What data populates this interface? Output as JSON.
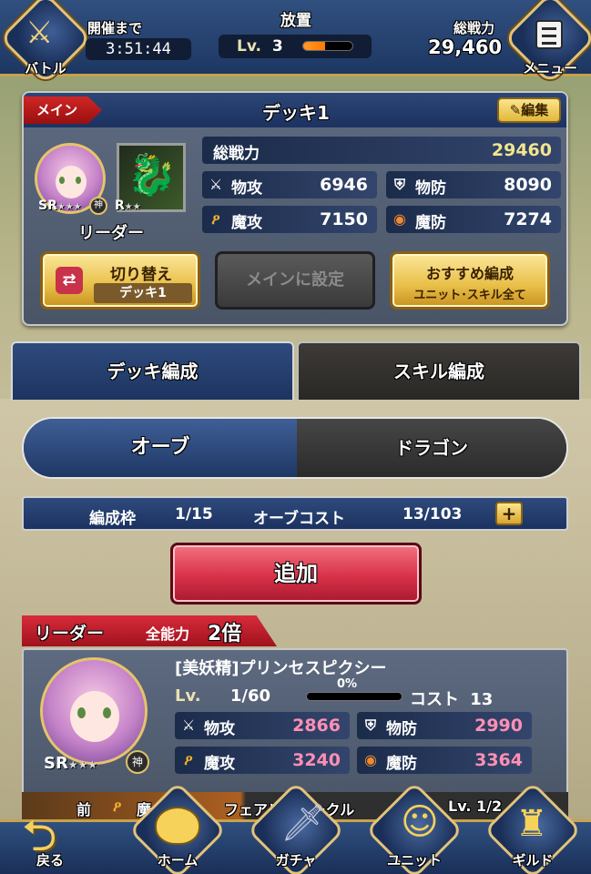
{
  "topbar": {
    "battle_label": "バトル",
    "timer_label": "開催まで",
    "timer_value": "3:51:44",
    "mode_label": "放置",
    "level_prefix": "Lv.",
    "level_value": "3",
    "level_progress": 0.45,
    "total_power_label": "総戦力",
    "total_power_value": "29,460",
    "menu_label": "メニュー"
  },
  "deck": {
    "main_tag": "メイン",
    "title": "デッキ1",
    "edit_label": "編集",
    "leader_rarity": "SR",
    "leader_rank": "神",
    "dragon_rarity": "R",
    "leader_label": "リーダー",
    "total_power_label": "総戦力",
    "total_power_value": "29460",
    "stats": [
      {
        "name": "物攻",
        "value": "6946",
        "icon": "sword-icon"
      },
      {
        "name": "物防",
        "value": "8090",
        "icon": "shield-icon"
      },
      {
        "name": "魔攻",
        "value": "7150",
        "icon": "magic-staff-icon"
      },
      {
        "name": "魔防",
        "value": "7274",
        "icon": "magic-shield-icon"
      }
    ],
    "switch_btn_title": "切り替え",
    "switch_btn_sub": "デッキ1",
    "set_main_label": "メインに設定",
    "recommend_title": "おすすめ編成",
    "recommend_sub": "ユニット･スキル全て"
  },
  "tabs": {
    "deck_edit": "デッキ編成",
    "skill_edit": "スキル編成"
  },
  "segment": {
    "orb": "オーブ",
    "dragon": "ドラゴン"
  },
  "cost_bar": {
    "slots_label": "編成枠",
    "slots_value": "1/15",
    "orb_cost_label": "オーブコスト",
    "orb_cost_value": "13/103",
    "plus": "+"
  },
  "add_button": "追加",
  "leader_card": {
    "tag_label": "リーダー",
    "bonus_prefix": "全能力",
    "bonus_value": "2倍",
    "name": "[美妖精]プリンセスピクシー",
    "lv_label": "Lv.",
    "lv_value": "1/60",
    "exp_percent_label": "0%",
    "exp_progress": 0,
    "cost_label": "コスト",
    "cost_value": "13",
    "rarity": "SR",
    "rank": "神",
    "stats": [
      {
        "name": "物攻",
        "value": "2866",
        "icon": "sword-icon"
      },
      {
        "name": "物防",
        "value": "2990",
        "icon": "shield-icon"
      },
      {
        "name": "魔攻",
        "value": "3240",
        "icon": "magic-staff-icon"
      },
      {
        "name": "魔防",
        "value": "3364",
        "icon": "magic-shield-icon"
      }
    ]
  },
  "skill_strip": {
    "prefix": "前",
    "attr": "魔",
    "skill_name": "フェアリーサークル",
    "lv_text": "Lv. 1/2"
  },
  "nav": {
    "back": "戻る",
    "home": "ホーム",
    "gacha": "ガチャ",
    "unit": "ユニット",
    "guild": "ギルド"
  },
  "colors": {
    "accent_gold": "#e1c27a",
    "navy": "#1d3461",
    "red_button": "#d83148",
    "pink_value": "#ff8fb4"
  }
}
